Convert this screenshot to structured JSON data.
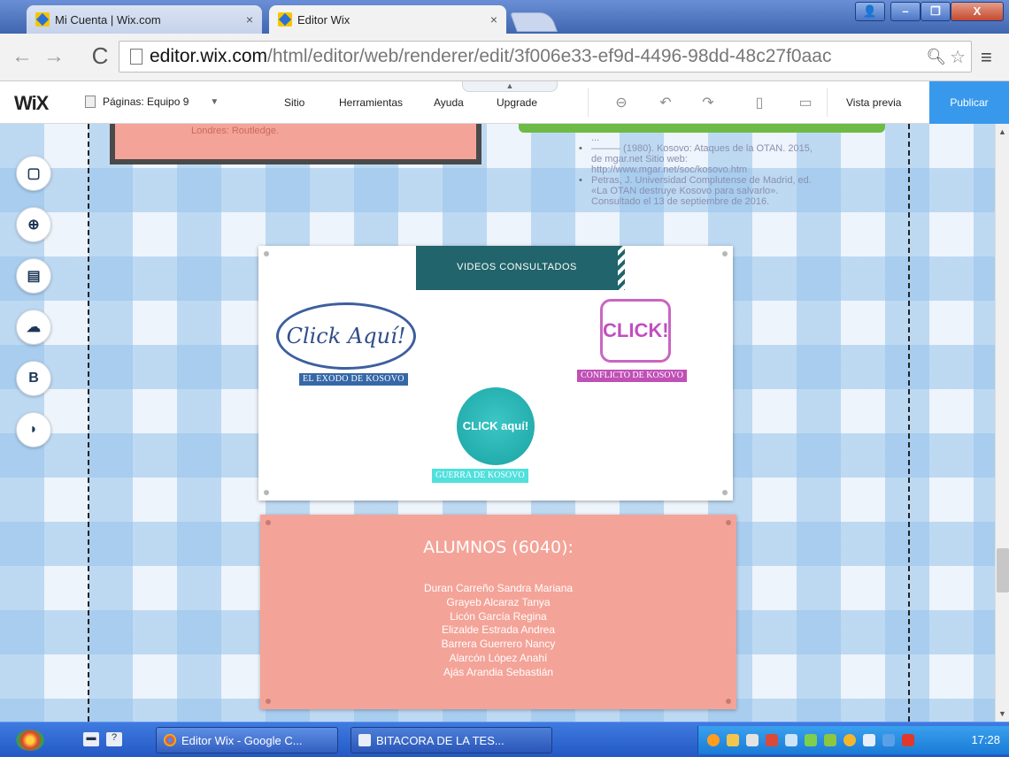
{
  "browser": {
    "tabs": [
      {
        "title": "Mi Cuenta | Wix.com",
        "active": false
      },
      {
        "title": "Editor Wix",
        "active": true
      }
    ],
    "tab_close_glyph": "×",
    "url": {
      "domain": "editor.wix.com",
      "path": "/html/editor/web/renderer/edit/3f006e33-ef9d-4496-98dd-48c27f0aac"
    },
    "window_buttons": {
      "user": "👤",
      "minimize": "–",
      "maximize": "❐",
      "close": "X"
    }
  },
  "wix": {
    "logo": "WiX",
    "pages_label": "Páginas: Equipo 9",
    "menu": {
      "sitio": "Sitio",
      "herramientas": "Herramientas",
      "ayuda": "Ayuda",
      "upgrade": "Upgrade"
    },
    "vista_previa": "Vista previa",
    "publicar": "Publicar",
    "accent": "#3899ec"
  },
  "canvas": {
    "ref_left_text": "Londres: Routledge.",
    "references": [
      {
        "text": "...",
        "bullet": false
      },
      {
        "text": "——— (1980). Kosovo: Ataques de la OTAN. 2015, de mgar.net Sitio web: http://www.mgar.net/soc/kosovo.htm",
        "bullet": true
      },
      {
        "text": "Petras, J. Universidad Complutense de Madrid, ed. «La OTAN destruye Kosovo para salvarlo». Consultado el 13 de septiembre de 2016.",
        "bullet": true
      }
    ],
    "videos": {
      "title": "VIDEOS CONSULTADOS",
      "buttons": [
        {
          "text": "Click Aquí!",
          "label": "EL EXODO DE KOSOVO"
        },
        {
          "text": "CLICK!",
          "label": "CONFLICTO DE KOSOVO"
        },
        {
          "text": "CLICK aquí!",
          "label": "GUERRA DE KOSOVO"
        }
      ]
    },
    "alumnos": {
      "title": "ALUMNOS (6040):",
      "names": [
        "Duran Carreño Sandra Mariana",
        "Grayeb Alcaraz Tanya",
        "Licón García Regina",
        "Elizalde Estrada Andrea",
        "Barrera Guerrero Nancy",
        "Alarcón López Anahí",
        "Ajás Arandia Sebastián"
      ],
      "color": "#f4a398"
    }
  },
  "taskbar": {
    "items": [
      {
        "label": "Editor Wix - Google C..."
      },
      {
        "label": "BITACORA DE LA TES..."
      }
    ],
    "clock": "17:28"
  }
}
